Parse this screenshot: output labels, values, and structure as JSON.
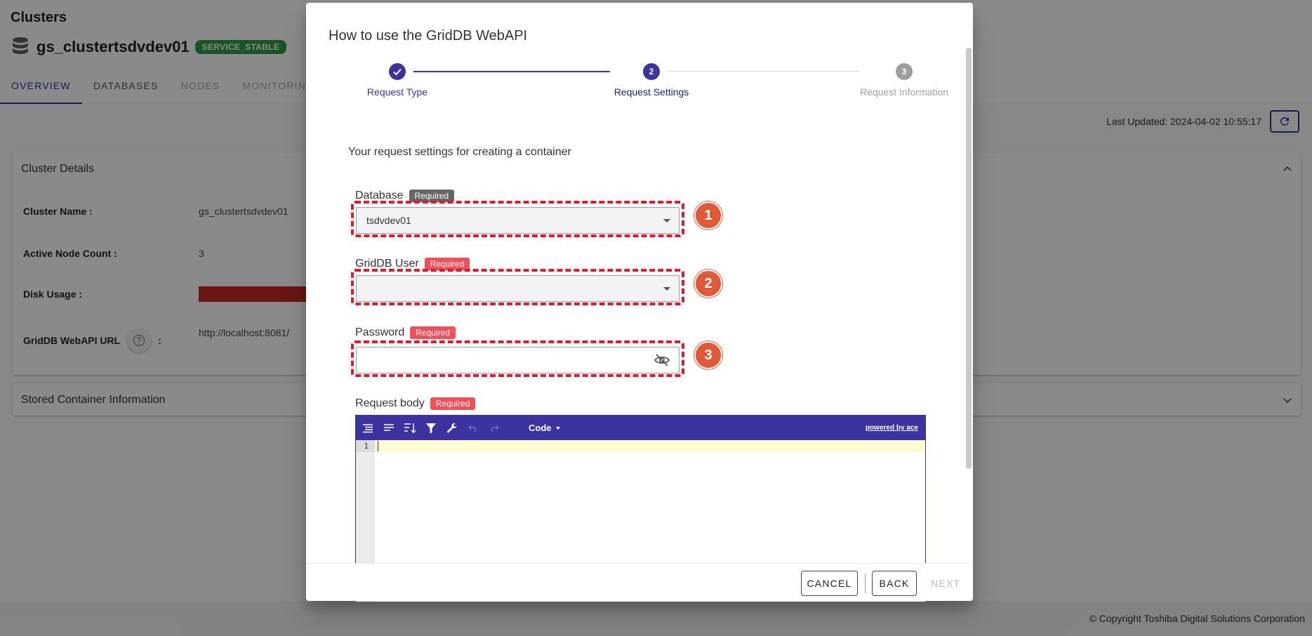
{
  "page": {
    "title": "Clusters",
    "cluster_name": "gs_clustertsdvdev01",
    "status_badge": "SERVICE_STABLE",
    "tabs": [
      {
        "label": "OVERVIEW",
        "state": "active"
      },
      {
        "label": "DATABASES",
        "state": "normal"
      },
      {
        "label": "NODES",
        "state": "disabled"
      },
      {
        "label": "MONITORING",
        "state": "disabled"
      }
    ],
    "last_updated": "Last Updated: 2024-04-02 10:55:17",
    "cluster_details": {
      "header": "Cluster Details",
      "rows": [
        {
          "label": "Cluster Name :",
          "value": "gs_clustertsdvdev01"
        },
        {
          "label": "Active Node Count :",
          "value": "3"
        },
        {
          "label": "Disk Usage :",
          "value": ""
        },
        {
          "label": "GridDB WebAPI URL",
          "value": "http://localhost:8081/"
        }
      ],
      "url_colon": ":"
    },
    "stored_container": {
      "header": "Stored Container Information"
    },
    "copyright": "© Copyright Toshiba Digital Solutions Corporation"
  },
  "dialog": {
    "title": "How to use the GridDB WebAPI",
    "steps": [
      {
        "number": "1",
        "label": "Request Type",
        "state": "complete"
      },
      {
        "number": "2",
        "label": "Request Settings",
        "state": "active"
      },
      {
        "number": "3",
        "label": "Request Information",
        "state": "inactive"
      }
    ],
    "intro": "Your request settings for creating a container",
    "fields": {
      "database": {
        "label": "Database",
        "badge": "Required",
        "value": "tsdvdev01",
        "callout": "1"
      },
      "user": {
        "label": "GridDB User",
        "badge": "Required",
        "value": "",
        "callout": "2"
      },
      "password": {
        "label": "Password",
        "badge": "Required",
        "value": "",
        "callout": "3"
      }
    },
    "request_body": {
      "label": "Request body",
      "badge": "Required",
      "mode": "Code",
      "powered_by": "powered by ace",
      "line_number": "1"
    },
    "buttons": {
      "cancel": "CANCEL",
      "back": "BACK",
      "next": "NEXT"
    }
  },
  "colors": {
    "primary": "#283593",
    "editor_toolbar": "#3c32a0",
    "required_red": "#f0505a",
    "callout": "#e05a38",
    "highlight_dash": "#e01a2a",
    "status_green": "#2e9e45"
  }
}
